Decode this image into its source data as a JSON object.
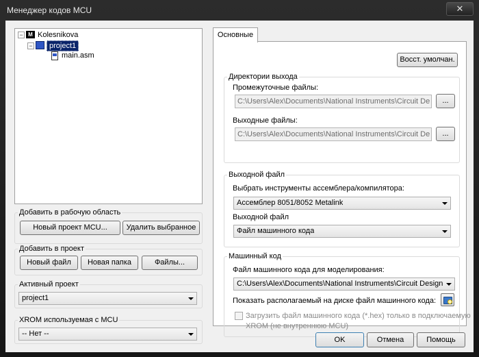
{
  "window": {
    "title": "Менеджер кодов MCU",
    "close": "✕"
  },
  "tree": {
    "root": "Kolesnikova",
    "project": "project1",
    "file": "main.asm"
  },
  "workspace": {
    "label": "Добавить в рабочую область",
    "new_project": "Новый проект  MCU...",
    "remove_selected": "Удалить выбранное"
  },
  "add_to_project": {
    "label": "Добавить в проект",
    "new_file": "Новый файл",
    "new_folder": "Новая папка",
    "files": "Файлы..."
  },
  "active_project": {
    "label": "Активный проект",
    "value": "project1"
  },
  "xrom": {
    "label": "XROM используемая с MCU",
    "value": "-- Нет --"
  },
  "tabs": {
    "main": "Основные"
  },
  "restore_defaults": "Восст. умолчан.",
  "output_dirs": {
    "label": "Директории выхода",
    "intermediate_label": "Промежуточные файлы:",
    "intermediate_value": "C:\\Users\\Alex\\Documents\\National Instruments\\Circuit Design S",
    "output_label": "Выходные файлы:",
    "output_value": "C:\\Users\\Alex\\Documents\\National Instruments\\Circuit Design S",
    "browse": "..."
  },
  "output_file": {
    "label": "Выходной файл",
    "tools_label": "Выбрать инструменты ассемблера/компилятора:",
    "tools_value": "Ассемблер 8051/8052 Metalink",
    "file_label": "Выходной файл",
    "file_value": "Файл машинного кода"
  },
  "machine_code": {
    "label": "Машинный код",
    "sim_label": "Файл машинного кода для моделирования:",
    "sim_value": "C:\\Users\\Alex\\Documents\\National Instruments\\Circuit Design Suite",
    "show_label": "Показать располагаемый на диске файл машинного кода:",
    "load_line1": "Загрузить файл машинного кода (*.hex) только в подключаемую",
    "load_line2": "XROM (не внутреннюю MCU)"
  },
  "footer": {
    "ok": "OK",
    "cancel": "Отмена",
    "help": "Помощь"
  },
  "colors": {
    "title_text": "#e8e8e8",
    "tree_selection": "#0a246a",
    "dialog_bg": "#f0f0f0"
  }
}
